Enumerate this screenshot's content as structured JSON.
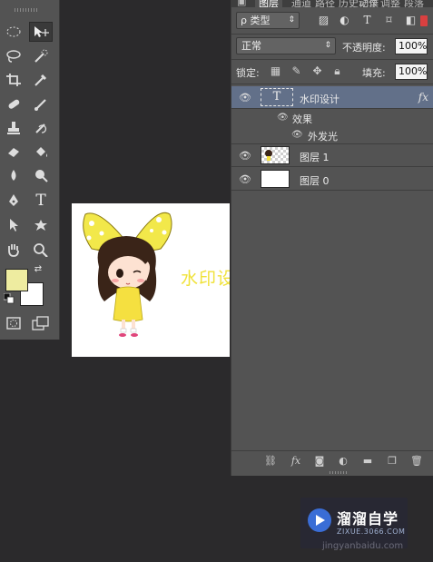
{
  "panel": {
    "tabs": [
      "图层",
      "通道",
      "路径",
      "历史记录",
      "动作",
      "调整",
      "段落"
    ],
    "active_tab": "图层",
    "filter": {
      "label": "ρ 类型"
    },
    "blend_mode": "正常",
    "opacity_label": "不透明度:",
    "opacity_value": "100%",
    "lock_label": "锁定:",
    "fill_label": "填充:",
    "fill_value": "100%",
    "layers": [
      {
        "name": "水印设计",
        "type": "text",
        "fx": "fx",
        "selected": true,
        "effects_label": "效果",
        "effects": [
          "外发光"
        ]
      },
      {
        "name": "图层 1",
        "type": "image"
      },
      {
        "name": "图层 0",
        "type": "fill-white"
      }
    ]
  },
  "canvas": {
    "watermark_text": "水印设"
  },
  "colors": {
    "foreground": "#eeeca0",
    "background": "#ffffff",
    "selection": "#627089"
  },
  "logo": {
    "title": "溜溜自学",
    "sub": "ZIXUE.3066.COM",
    "url": "jingyanbaidu.com"
  }
}
